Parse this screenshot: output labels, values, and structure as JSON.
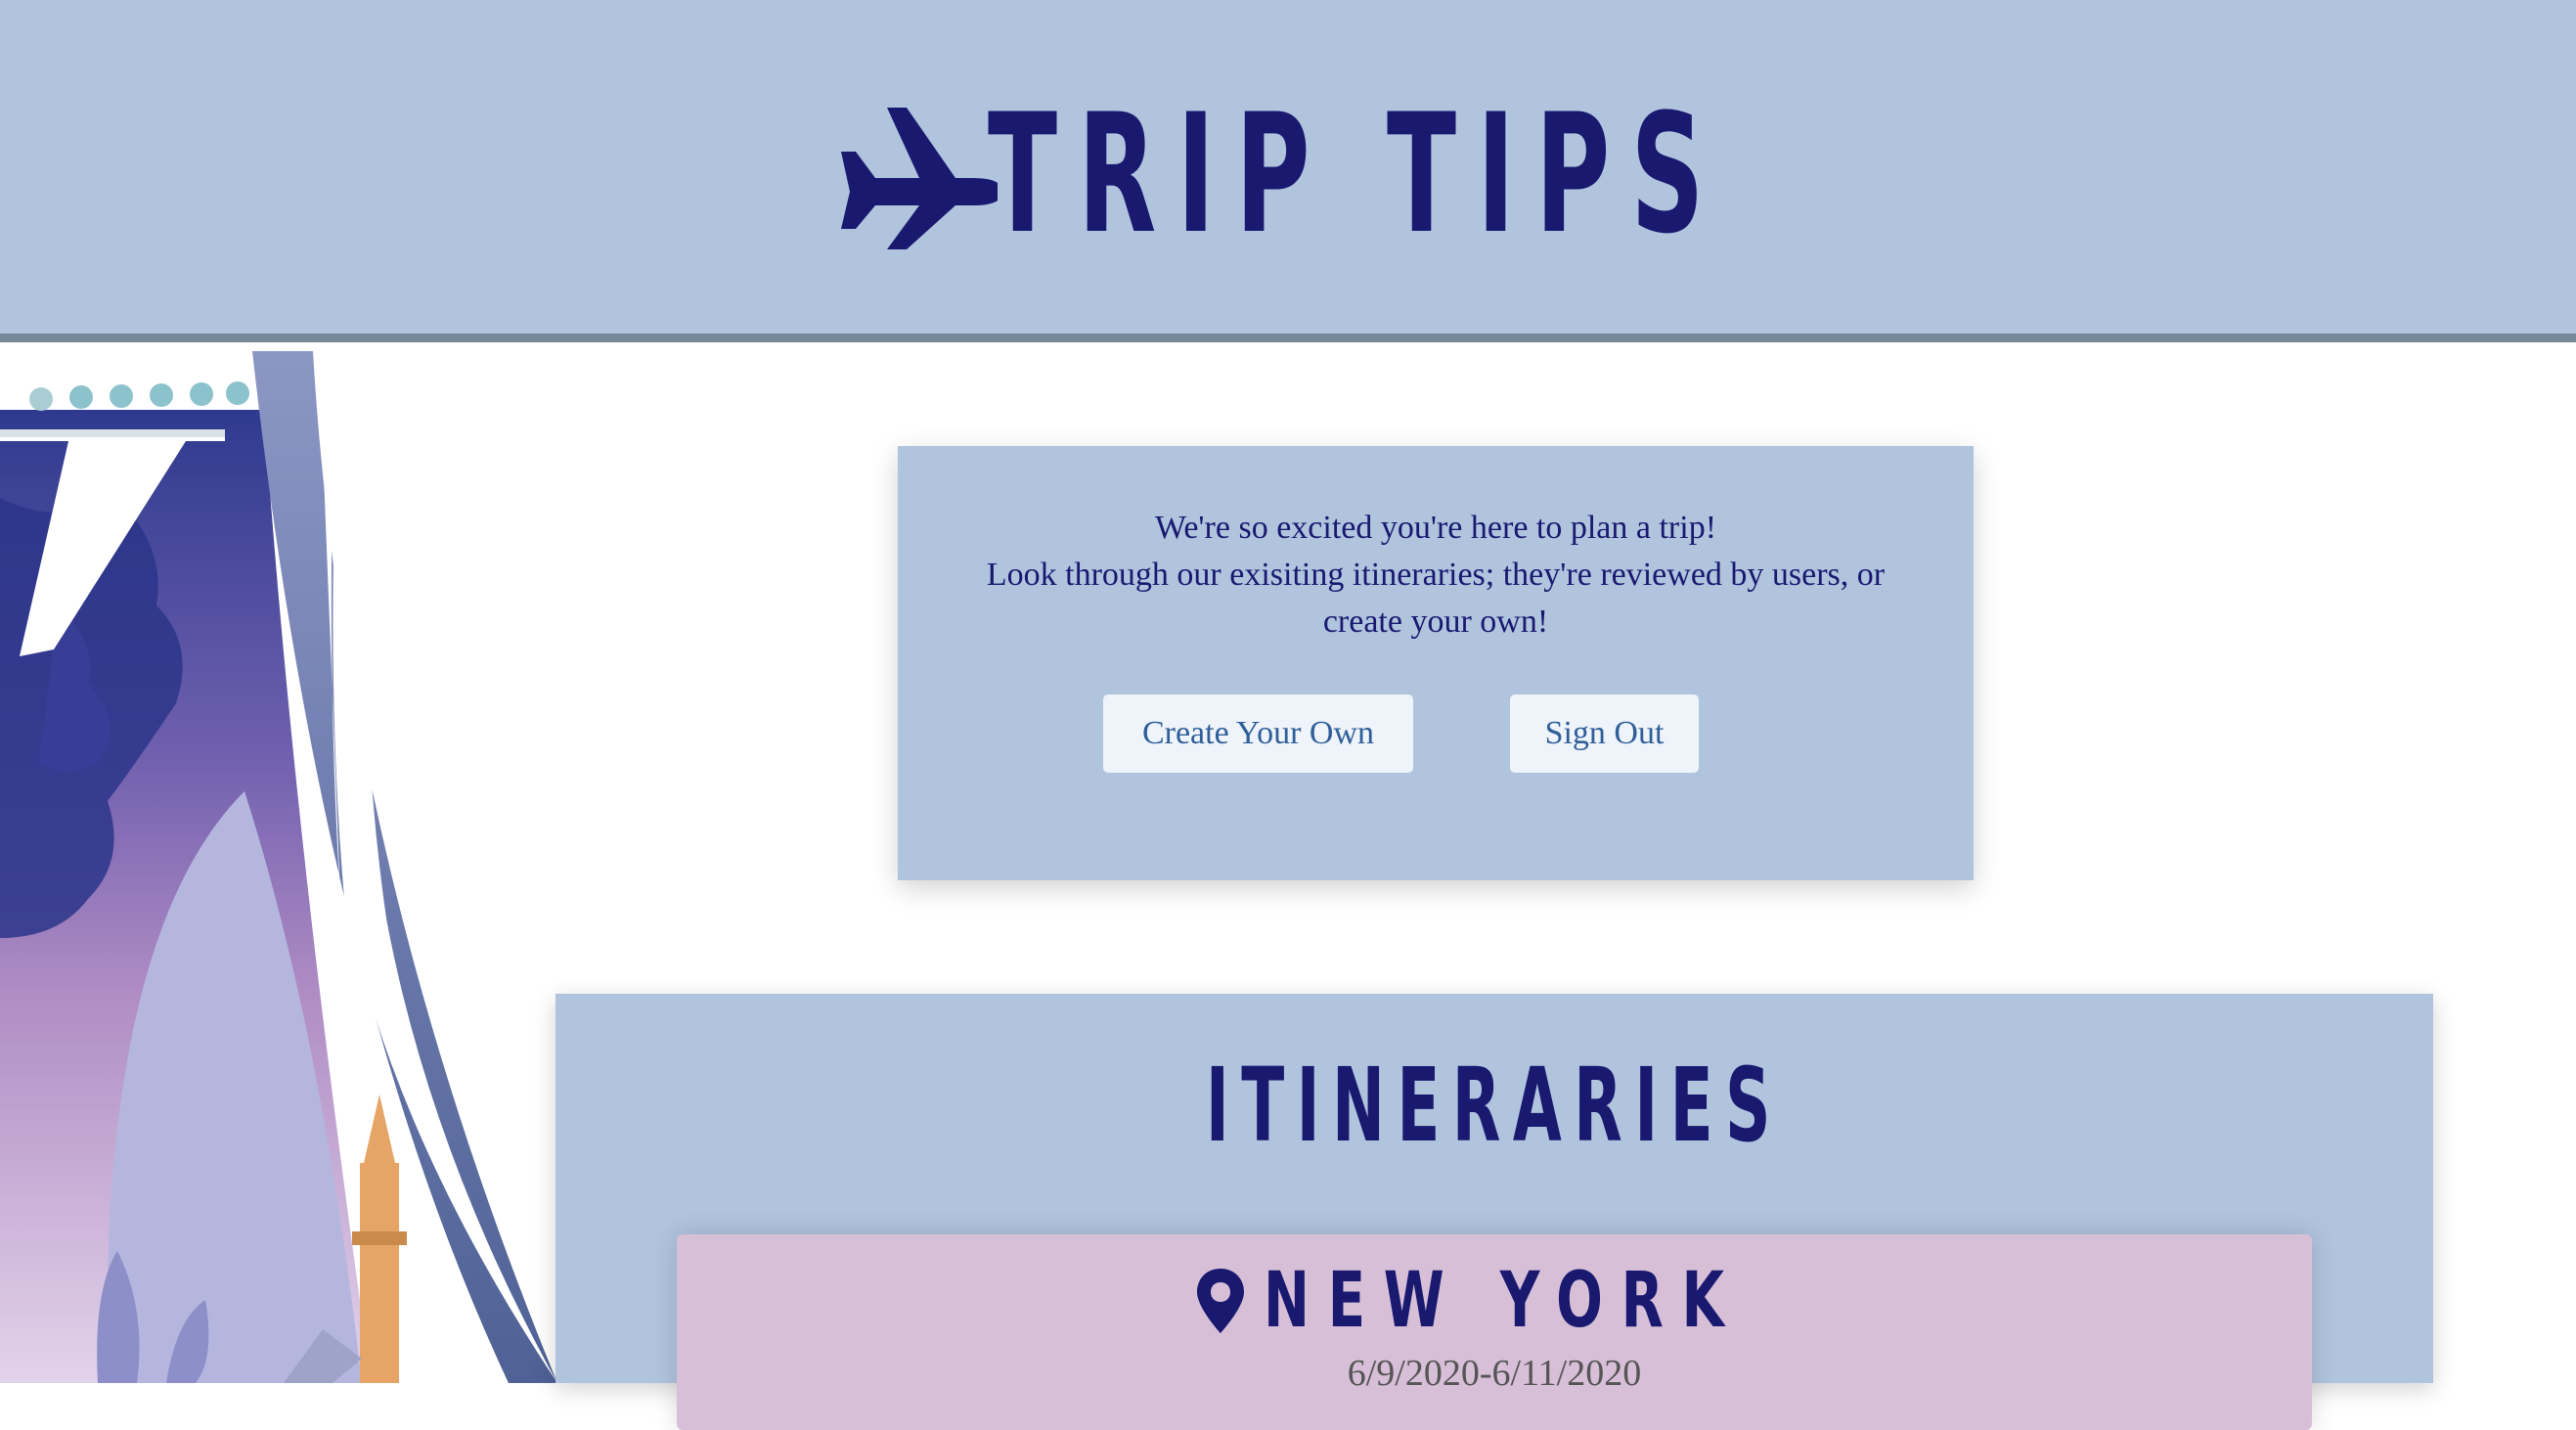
{
  "header": {
    "title": "TRIP TIPS",
    "logo_icon": "airplane-icon"
  },
  "welcome": {
    "line1": "We're so excited you're here to plan a trip!",
    "line2": "Look through our exisiting itineraries; they're reviewed by users, or",
    "line3": "create your own!",
    "create_button": "Create Your Own",
    "signout_button": "Sign Out"
  },
  "itineraries": {
    "title": "ITINERARIES",
    "items": [
      {
        "city": "NEW YORK",
        "dates": "6/9/2020-6/11/2020",
        "icon": "map-pin-icon"
      }
    ]
  },
  "colors": {
    "header_bg": "#b0c4de",
    "header_border": "#778899",
    "title_color": "#191970",
    "card_bg": "#b0c4de",
    "trip_card_bg": "#d8bfd8",
    "button_bg": "#eef4fa",
    "button_text": "#2f5e99"
  }
}
